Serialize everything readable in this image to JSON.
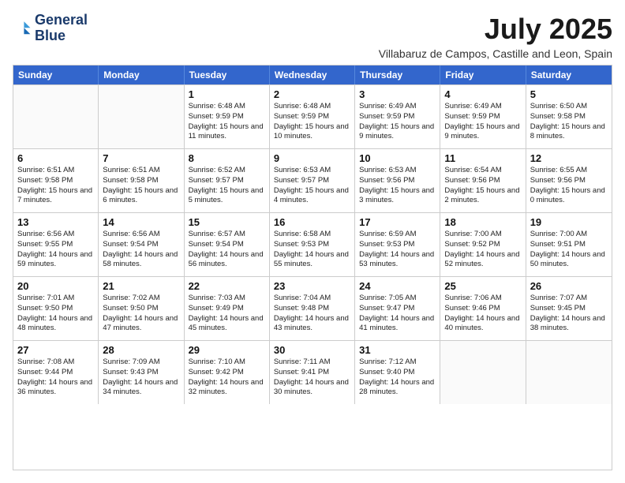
{
  "header": {
    "logo_line1": "General",
    "logo_line2": "Blue",
    "month": "July 2025",
    "location": "Villabaruz de Campos, Castille and Leon, Spain"
  },
  "days_of_week": [
    "Sunday",
    "Monday",
    "Tuesday",
    "Wednesday",
    "Thursday",
    "Friday",
    "Saturday"
  ],
  "weeks": [
    [
      {
        "day": "",
        "info": ""
      },
      {
        "day": "",
        "info": ""
      },
      {
        "day": "1",
        "info": "Sunrise: 6:48 AM\nSunset: 9:59 PM\nDaylight: 15 hours and 11 minutes."
      },
      {
        "day": "2",
        "info": "Sunrise: 6:48 AM\nSunset: 9:59 PM\nDaylight: 15 hours and 10 minutes."
      },
      {
        "day": "3",
        "info": "Sunrise: 6:49 AM\nSunset: 9:59 PM\nDaylight: 15 hours and 9 minutes."
      },
      {
        "day": "4",
        "info": "Sunrise: 6:49 AM\nSunset: 9:59 PM\nDaylight: 15 hours and 9 minutes."
      },
      {
        "day": "5",
        "info": "Sunrise: 6:50 AM\nSunset: 9:58 PM\nDaylight: 15 hours and 8 minutes."
      }
    ],
    [
      {
        "day": "6",
        "info": "Sunrise: 6:51 AM\nSunset: 9:58 PM\nDaylight: 15 hours and 7 minutes."
      },
      {
        "day": "7",
        "info": "Sunrise: 6:51 AM\nSunset: 9:58 PM\nDaylight: 15 hours and 6 minutes."
      },
      {
        "day": "8",
        "info": "Sunrise: 6:52 AM\nSunset: 9:57 PM\nDaylight: 15 hours and 5 minutes."
      },
      {
        "day": "9",
        "info": "Sunrise: 6:53 AM\nSunset: 9:57 PM\nDaylight: 15 hours and 4 minutes."
      },
      {
        "day": "10",
        "info": "Sunrise: 6:53 AM\nSunset: 9:56 PM\nDaylight: 15 hours and 3 minutes."
      },
      {
        "day": "11",
        "info": "Sunrise: 6:54 AM\nSunset: 9:56 PM\nDaylight: 15 hours and 2 minutes."
      },
      {
        "day": "12",
        "info": "Sunrise: 6:55 AM\nSunset: 9:56 PM\nDaylight: 15 hours and 0 minutes."
      }
    ],
    [
      {
        "day": "13",
        "info": "Sunrise: 6:56 AM\nSunset: 9:55 PM\nDaylight: 14 hours and 59 minutes."
      },
      {
        "day": "14",
        "info": "Sunrise: 6:56 AM\nSunset: 9:54 PM\nDaylight: 14 hours and 58 minutes."
      },
      {
        "day": "15",
        "info": "Sunrise: 6:57 AM\nSunset: 9:54 PM\nDaylight: 14 hours and 56 minutes."
      },
      {
        "day": "16",
        "info": "Sunrise: 6:58 AM\nSunset: 9:53 PM\nDaylight: 14 hours and 55 minutes."
      },
      {
        "day": "17",
        "info": "Sunrise: 6:59 AM\nSunset: 9:53 PM\nDaylight: 14 hours and 53 minutes."
      },
      {
        "day": "18",
        "info": "Sunrise: 7:00 AM\nSunset: 9:52 PM\nDaylight: 14 hours and 52 minutes."
      },
      {
        "day": "19",
        "info": "Sunrise: 7:00 AM\nSunset: 9:51 PM\nDaylight: 14 hours and 50 minutes."
      }
    ],
    [
      {
        "day": "20",
        "info": "Sunrise: 7:01 AM\nSunset: 9:50 PM\nDaylight: 14 hours and 48 minutes."
      },
      {
        "day": "21",
        "info": "Sunrise: 7:02 AM\nSunset: 9:50 PM\nDaylight: 14 hours and 47 minutes."
      },
      {
        "day": "22",
        "info": "Sunrise: 7:03 AM\nSunset: 9:49 PM\nDaylight: 14 hours and 45 minutes."
      },
      {
        "day": "23",
        "info": "Sunrise: 7:04 AM\nSunset: 9:48 PM\nDaylight: 14 hours and 43 minutes."
      },
      {
        "day": "24",
        "info": "Sunrise: 7:05 AM\nSunset: 9:47 PM\nDaylight: 14 hours and 41 minutes."
      },
      {
        "day": "25",
        "info": "Sunrise: 7:06 AM\nSunset: 9:46 PM\nDaylight: 14 hours and 40 minutes."
      },
      {
        "day": "26",
        "info": "Sunrise: 7:07 AM\nSunset: 9:45 PM\nDaylight: 14 hours and 38 minutes."
      }
    ],
    [
      {
        "day": "27",
        "info": "Sunrise: 7:08 AM\nSunset: 9:44 PM\nDaylight: 14 hours and 36 minutes."
      },
      {
        "day": "28",
        "info": "Sunrise: 7:09 AM\nSunset: 9:43 PM\nDaylight: 14 hours and 34 minutes."
      },
      {
        "day": "29",
        "info": "Sunrise: 7:10 AM\nSunset: 9:42 PM\nDaylight: 14 hours and 32 minutes."
      },
      {
        "day": "30",
        "info": "Sunrise: 7:11 AM\nSunset: 9:41 PM\nDaylight: 14 hours and 30 minutes."
      },
      {
        "day": "31",
        "info": "Sunrise: 7:12 AM\nSunset: 9:40 PM\nDaylight: 14 hours and 28 minutes."
      },
      {
        "day": "",
        "info": ""
      },
      {
        "day": "",
        "info": ""
      }
    ]
  ]
}
